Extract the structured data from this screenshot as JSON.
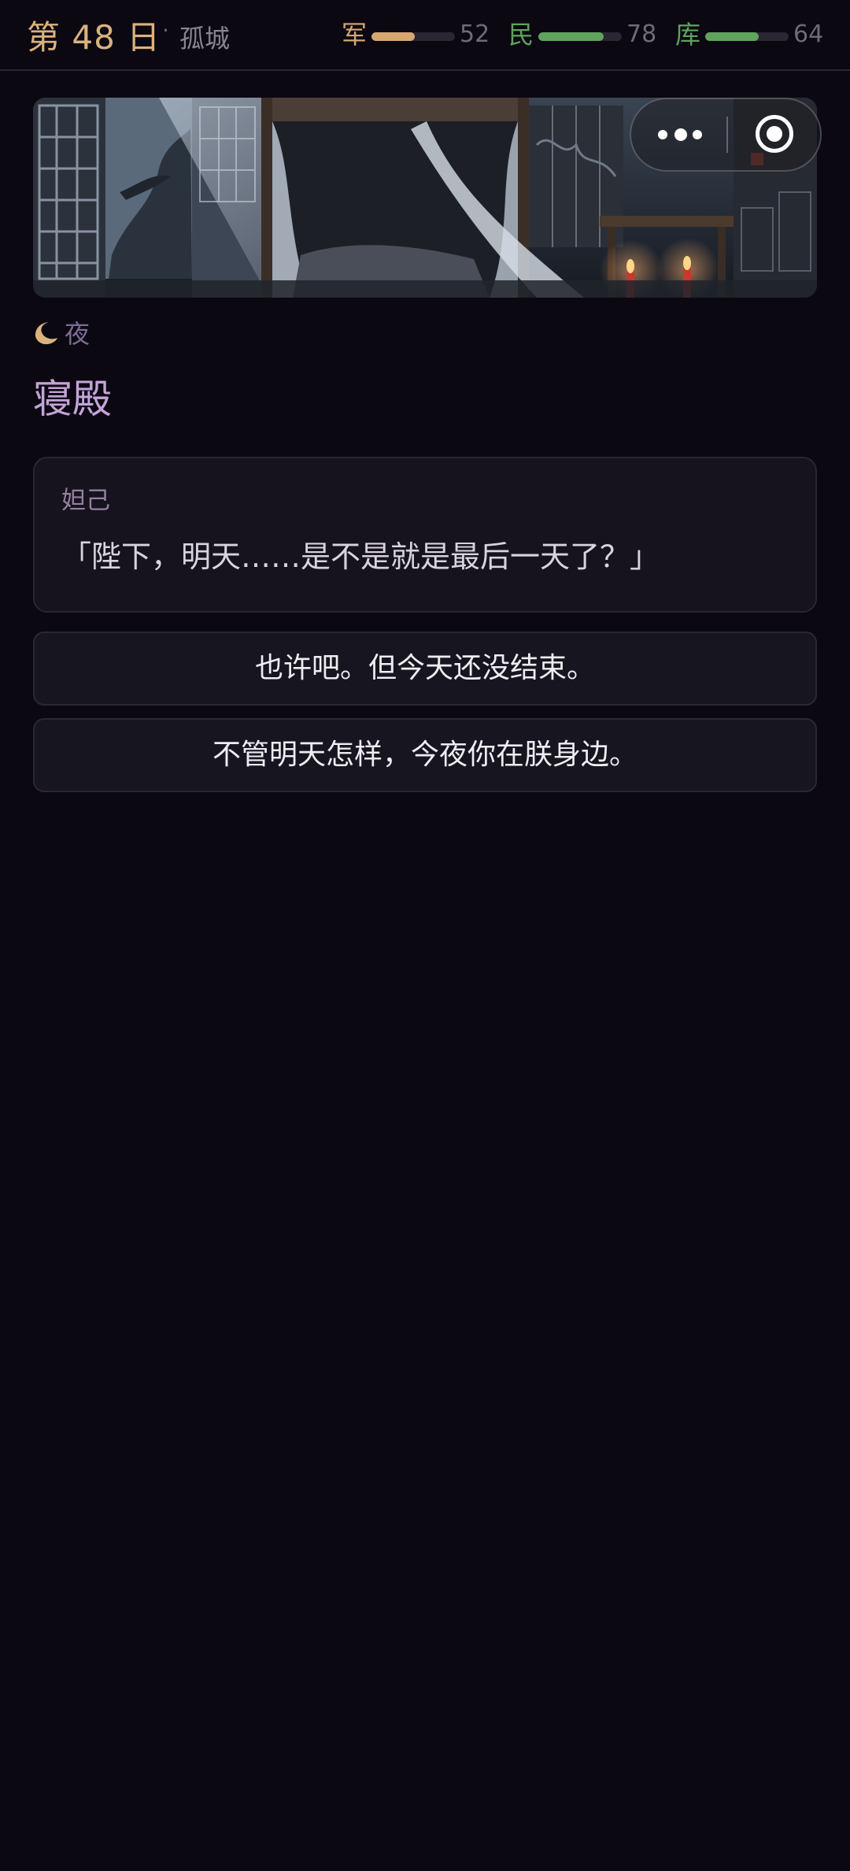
{
  "header": {
    "day": "第 48 日",
    "separator": "·",
    "location": "孤城",
    "stats": [
      {
        "label": "军",
        "value": "52",
        "level": 0.52,
        "color": "#d4a870"
      },
      {
        "label": "民",
        "value": "78",
        "level": 0.78,
        "color": "#5fa35c"
      },
      {
        "label": "库",
        "value": "64",
        "level": 0.64,
        "color": "#5fa35c"
      }
    ]
  },
  "capsule": {
    "more_icon": "more-dots-icon",
    "close_icon": "target-close-icon"
  },
  "scene": {
    "time_icon": "moon-icon",
    "time_of_day": "夜",
    "title": "寝殿"
  },
  "dialogue": {
    "speaker": "妲己",
    "text": "「陛下，明天……是不是就是最后一天了？」"
  },
  "choices": [
    {
      "label": "也许吧。但今天还没结束。"
    },
    {
      "label": "不管明天怎样，今夜你在朕身边。"
    }
  ],
  "colors": {
    "background": "#0b0812",
    "accent_gold": "#d9b27c",
    "accent_purple": "#c4a4d8",
    "time_purple": "#7f6b99"
  }
}
